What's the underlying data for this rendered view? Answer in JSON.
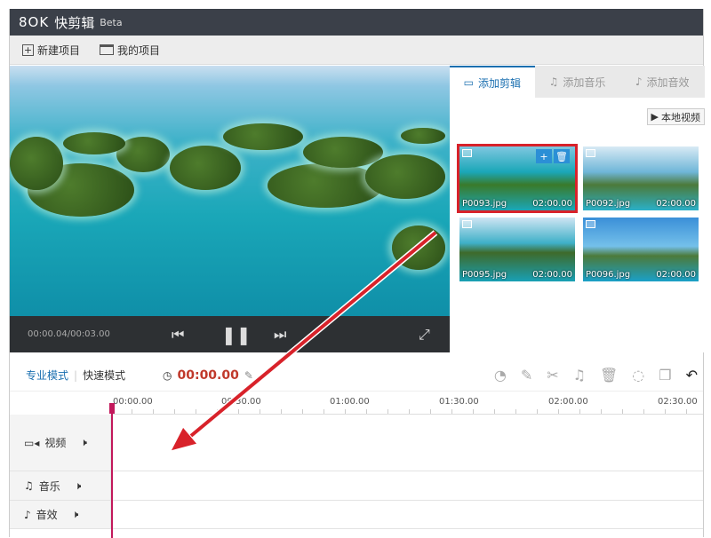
{
  "app": {
    "logo": "8OK",
    "name": "快剪辑",
    "badge": "Beta"
  },
  "toolbar": {
    "new_project": "新建项目",
    "my_projects": "我的项目"
  },
  "player": {
    "time": "00:00.04/00:03.00"
  },
  "panel": {
    "tabs": [
      {
        "label": "添加剪辑",
        "active": true
      },
      {
        "label": "添加音乐"
      },
      {
        "label": "添加音效"
      }
    ],
    "local_button": "本地视频",
    "clips": [
      {
        "name": "P0093.jpg",
        "duration": "02:00.00",
        "selected": true
      },
      {
        "name": "P0092.jpg",
        "duration": "02:00.00"
      },
      {
        "name": "P0095.jpg",
        "duration": "02:00.00"
      },
      {
        "name": "P0096.jpg",
        "duration": "02:00.00"
      }
    ]
  },
  "timeline": {
    "modes": [
      "专业模式",
      "快速模式"
    ],
    "timecode": "00:00.00",
    "ticks": [
      "00:00.00",
      "00:30.00",
      "01:00.00",
      "01:30.00",
      "02:00.00",
      "02:30.00"
    ],
    "tracks": [
      "视频",
      "音乐",
      "音效"
    ]
  },
  "colors": {
    "accent": "#1a6fb0",
    "timecode": "#c0392b",
    "highlight": "#d8222a",
    "arrow": "#d8222a"
  }
}
